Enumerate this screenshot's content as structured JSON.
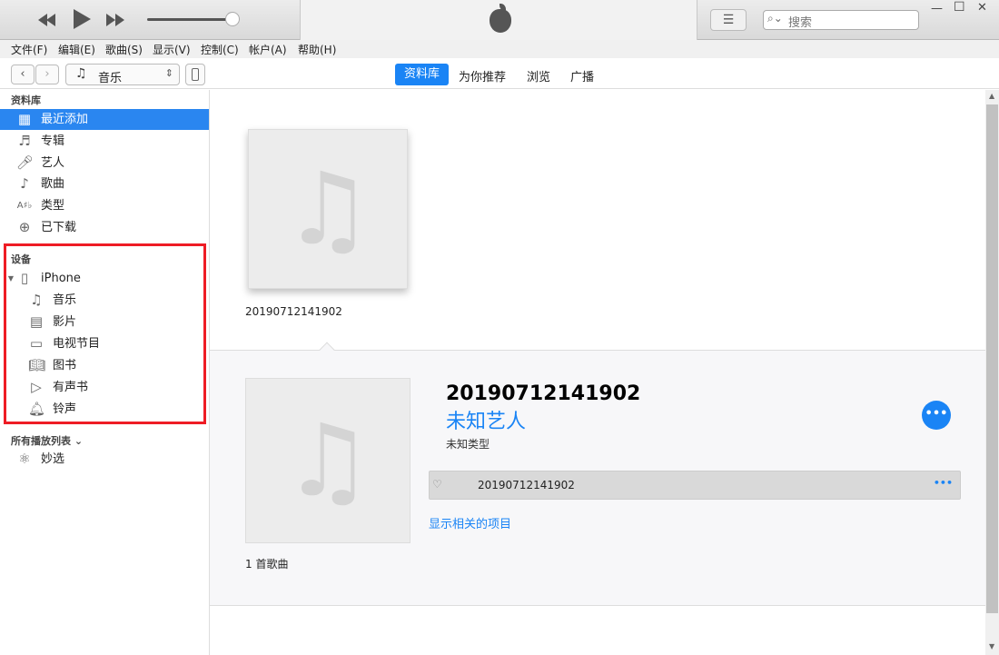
{
  "window": {
    "search_placeholder": "搜索",
    "minimize": "—",
    "maximize": "☐",
    "close": "✕"
  },
  "menu": [
    "文件(F)",
    "编辑(E)",
    "歌曲(S)",
    "显示(V)",
    "控制(C)",
    "帐户(A)",
    "帮助(H)"
  ],
  "nav": {
    "media_select": "音乐",
    "tabs": [
      {
        "label": "资料库",
        "active": true
      },
      {
        "label": "为你推荐"
      },
      {
        "label": "浏览"
      },
      {
        "label": "广播"
      }
    ]
  },
  "player": {
    "volume_fraction": 0.95
  },
  "sidebar": {
    "library_header": "资料库",
    "library": [
      {
        "label": "最近添加",
        "icon": "grid-icon",
        "selected": true
      },
      {
        "label": "专辑",
        "icon": "album-icon"
      },
      {
        "label": "艺人",
        "icon": "microphone-icon"
      },
      {
        "label": "歌曲",
        "icon": "note-icon"
      },
      {
        "label": "类型",
        "icon": "genre-icon"
      },
      {
        "label": "已下载",
        "icon": "download-icon"
      }
    ],
    "devices_header": "设备",
    "device": {
      "label": "iPhone"
    },
    "device_items": [
      {
        "label": "音乐",
        "icon": "music-icon"
      },
      {
        "label": "影片",
        "icon": "film-icon"
      },
      {
        "label": "电视节目",
        "icon": "tv-icon"
      },
      {
        "label": "图书",
        "icon": "book-icon"
      },
      {
        "label": "有声书",
        "icon": "audiobook-icon"
      },
      {
        "label": "铃声",
        "icon": "bell-icon"
      }
    ],
    "playlists_header": "所有播放列表",
    "playlists": [
      {
        "label": "妙选",
        "icon": "genius-icon"
      }
    ],
    "highlight_color": "#ee1c25"
  },
  "main": {
    "album_caption": "20190712141902",
    "detail": {
      "title": "20190712141902",
      "artist": "未知艺人",
      "genre": "未知类型",
      "song": "20190712141902",
      "related_link": "显示相关的项目",
      "count": "1 首歌曲"
    },
    "accent": "#1a84f5"
  }
}
